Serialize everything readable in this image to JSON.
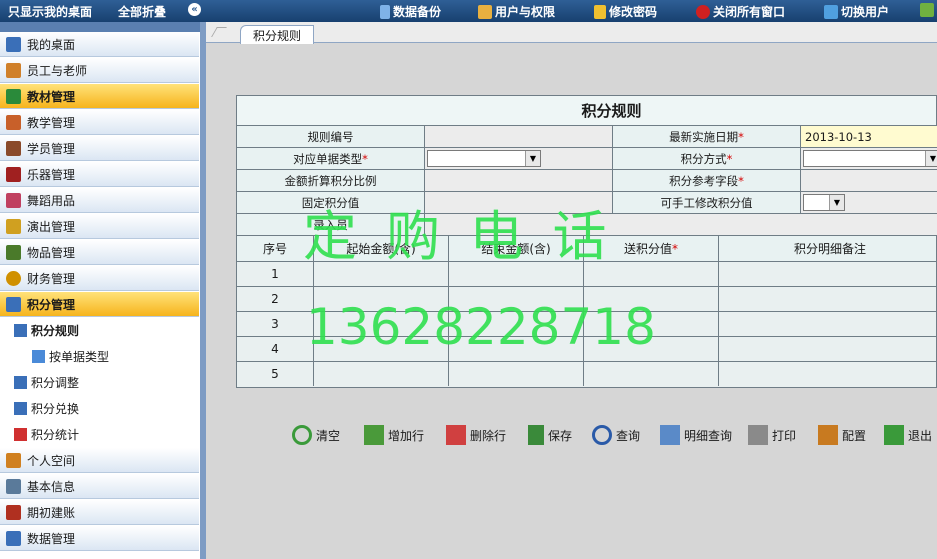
{
  "topbar": {
    "show_desktop": "只显示我的桌面",
    "collapse_all": "全部折叠",
    "collapse_icon": "«",
    "data_backup": "数据备份",
    "users_rights": "用户与权限",
    "change_password": "修改密码",
    "close_all": "关闭所有窗口",
    "switch_user": "切换用户"
  },
  "sidebar": {
    "items": [
      {
        "label": "我的桌面",
        "icon": "desktop-icon",
        "color": "#3a6fb8"
      },
      {
        "label": "员工与老师",
        "icon": "people-icon",
        "color": "#d0802a"
      },
      {
        "label": "教材管理",
        "icon": "books-icon",
        "color": "#2a8a3a"
      },
      {
        "label": "教学管理",
        "icon": "calendar-icon",
        "color": "#c8602a"
      },
      {
        "label": "学员管理",
        "icon": "student-icon",
        "color": "#8a4a2a"
      },
      {
        "label": "乐器管理",
        "icon": "instrument-icon",
        "color": "#a02020"
      },
      {
        "label": "舞蹈用品",
        "icon": "dance-icon",
        "color": "#c04060"
      },
      {
        "label": "演出管理",
        "icon": "performance-icon",
        "color": "#d0a020"
      },
      {
        "label": "物品管理",
        "icon": "items-icon",
        "color": "#4a7a2a"
      },
      {
        "label": "财务管理",
        "icon": "finance-icon",
        "color": "#d09000"
      },
      {
        "label": "积分管理",
        "icon": "points-icon",
        "color": "#3a6fb8"
      }
    ],
    "sub_items": [
      {
        "label": "积分规则",
        "icon": "rule-icon",
        "color": "#3a6fb8"
      },
      {
        "label": "按单据类型",
        "icon": "folder-icon",
        "color": "#4a8ad8"
      },
      {
        "label": "积分调整",
        "icon": "adjust-icon",
        "color": "#3a6fb8"
      },
      {
        "label": "积分兑换",
        "icon": "exchange-icon",
        "color": "#3a6fb8"
      },
      {
        "label": "积分统计",
        "icon": "stats-icon",
        "color": "#d03030"
      }
    ],
    "bottom_items": [
      {
        "label": "个人空间",
        "icon": "personal-icon",
        "color": "#d08020"
      },
      {
        "label": "基本信息",
        "icon": "info-icon",
        "color": "#5a7a9a"
      },
      {
        "label": "期初建账",
        "icon": "ledger-icon",
        "color": "#b03020"
      },
      {
        "label": "数据管理",
        "icon": "database-icon",
        "color": "#3a6fb8"
      }
    ]
  },
  "tab": {
    "label": "积分规则"
  },
  "form": {
    "title": "积分规则",
    "rule_no_label": "规则编号",
    "rule_no_value": "",
    "latest_date_label": "最新实施日期",
    "latest_date_value": "2013-10-13",
    "doc_type_label": "对应单据类型",
    "doc_type_value": "",
    "points_method_label": "积分方式",
    "points_method_value": "",
    "amount_ratio_label": "金额折算积分比例",
    "points_field_label": "积分参考字段",
    "fixed_points_label": "固定积分值",
    "manual_edit_label": "可手工修改积分值",
    "manual_edit_value": "",
    "entry_label": "录入员",
    "req": "*"
  },
  "grid": {
    "headers": [
      "序号",
      "起始金额(含)",
      "结束金额(含)",
      "送积分值",
      "积分明细备注"
    ],
    "rows": [
      "1",
      "2",
      "3",
      "4",
      "5"
    ]
  },
  "toolbar": {
    "clear": "清空",
    "add_row": "增加行",
    "delete_row": "删除行",
    "save": "保存",
    "query": "查询",
    "detail_query": "明细查询",
    "print": "打印",
    "config": "配置",
    "exit": "退出"
  },
  "watermark": {
    "line1": "定 购 电 话",
    "line2": "13628228718",
    "color": "#2fe04f"
  }
}
